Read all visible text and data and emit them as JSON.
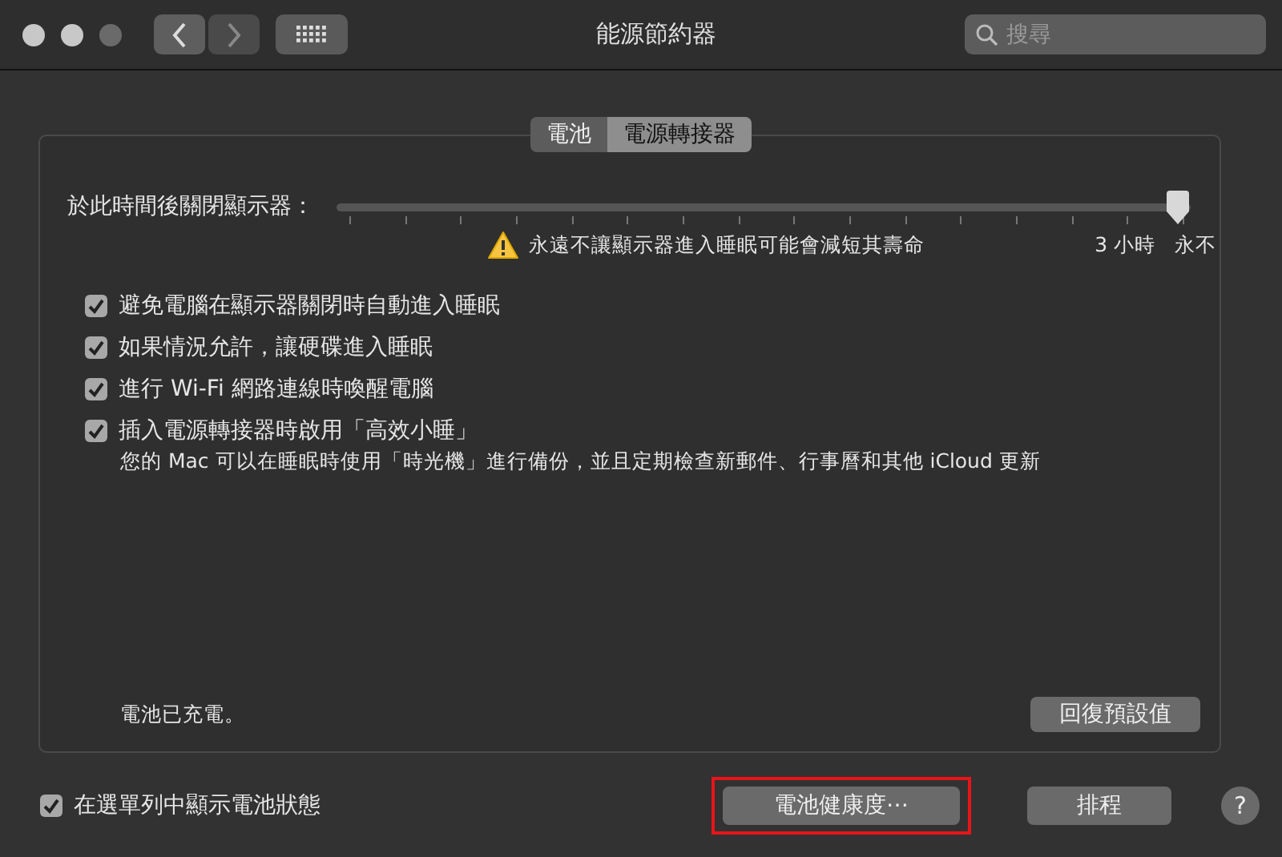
{
  "window": {
    "title": "能源節約器",
    "search": {
      "placeholder": "搜尋"
    }
  },
  "tabs": [
    {
      "label": "電池",
      "selected": false
    },
    {
      "label": "電源轉接器",
      "selected": true
    }
  ],
  "display_sleep": {
    "label": "於此時間後關閉顯示器：",
    "level": 1,
    "warning": "永遠不讓顯示器進入睡眠可能會減短其壽命",
    "marks": [
      "3 小時",
      "永不"
    ]
  },
  "options": [
    {
      "label": "避免電腦在顯示器關閉時自動進入睡眠",
      "checked": true
    },
    {
      "label": "如果情況允許，讓硬碟進入睡眠",
      "checked": true
    },
    {
      "label": "進行 Wi-Fi 網路連線時喚醒電腦",
      "checked": true
    },
    {
      "label": "插入電源轉接器時啟用「高效小睡」",
      "checked": true,
      "note": "您的 Mac 可以在睡眠時使用「時光機」進行備份，並且定期檢查新郵件、行事曆和其他 iCloud 更新"
    }
  ],
  "status": "電池已充電。",
  "restore_button": "回復預設值",
  "footer": {
    "menu_bar_option": {
      "label": "在選單列中顯示電池狀態",
      "checked": true
    },
    "buttons": [
      {
        "label": "電池健康度⋯",
        "highlighted": true
      },
      {
        "label": "排程",
        "highlighted": false
      }
    ],
    "help": "?"
  }
}
